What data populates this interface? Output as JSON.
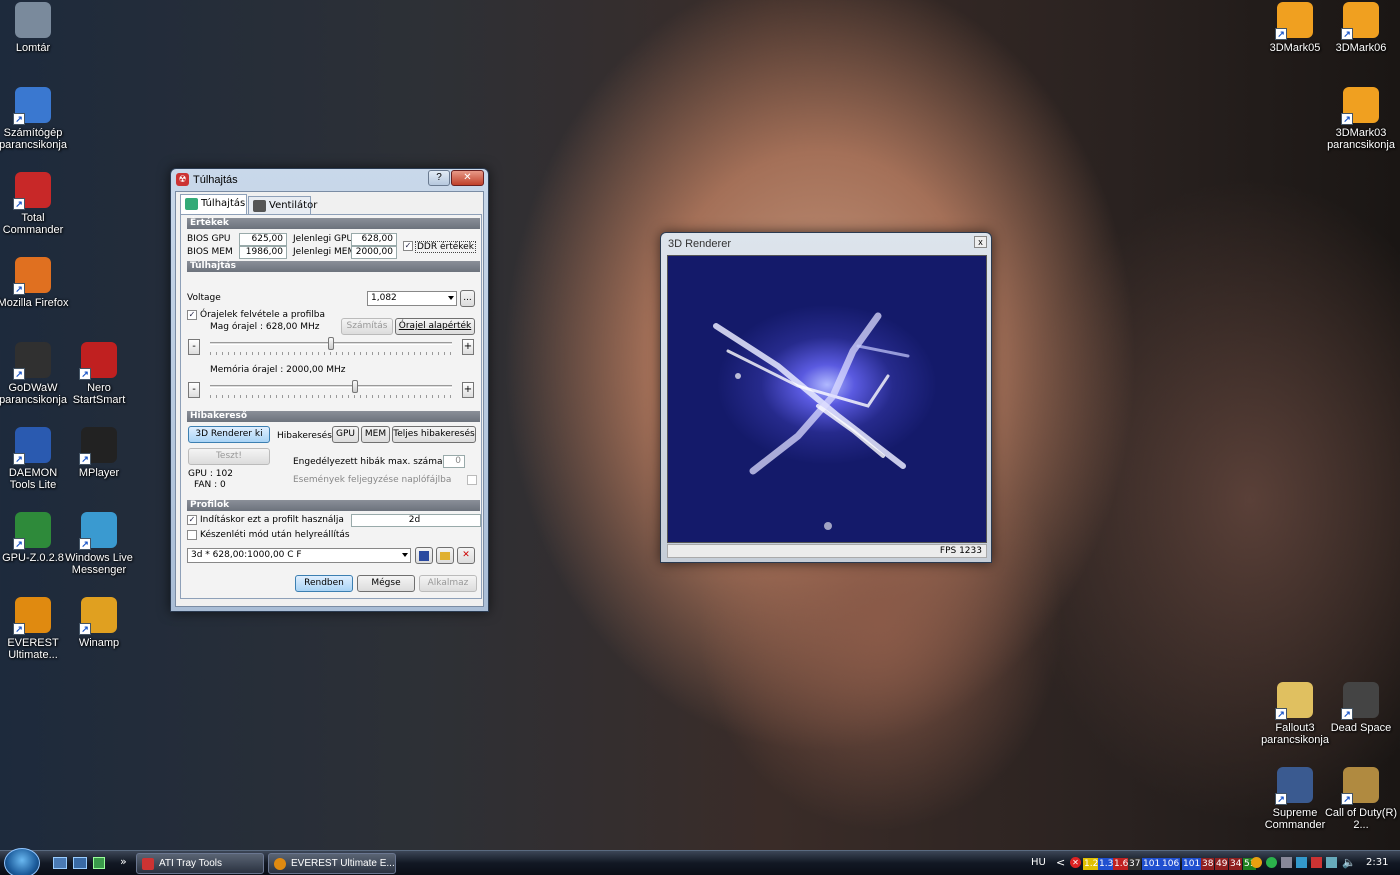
{
  "desktop": {
    "icons_left": [
      {
        "label": "Lomtár",
        "icon": "recycle-bin-icon"
      },
      {
        "label": "Számítógép parancsikonja",
        "icon": "computer-icon"
      },
      {
        "label": "Total Commander",
        "icon": "floppy-icon"
      },
      {
        "label": "Mozilla Firefox",
        "icon": "firefox-icon"
      },
      {
        "label": "GoDWaW parancsikonja",
        "icon": "star-icon"
      },
      {
        "label": "Nero StartSmart",
        "icon": "nero-icon"
      },
      {
        "label": "DAEMON Tools Lite",
        "icon": "daemon-tools-icon"
      },
      {
        "label": "MPlayer",
        "icon": "mplayer-icon"
      },
      {
        "label": "GPU-Z.0.2.8",
        "icon": "gpu-z-icon"
      },
      {
        "label": "Windows Live Messenger",
        "icon": "messenger-icon"
      },
      {
        "label": "EVEREST Ultimate...",
        "icon": "everest-icon"
      },
      {
        "label": "Winamp",
        "icon": "winamp-icon"
      }
    ],
    "icons_right": [
      {
        "label": "3DMark05",
        "icon": "3dmark-icon"
      },
      {
        "label": "3DMark06",
        "icon": "3dmark-icon"
      },
      {
        "label": "3DMark03 parancsikonja",
        "icon": "3dmark-icon"
      },
      {
        "label": "Fallout3 parancsikonja",
        "icon": "fallout-icon"
      },
      {
        "label": "Dead Space",
        "icon": "dead-space-icon"
      },
      {
        "label": "Supreme Commander",
        "icon": "supreme-commander-icon"
      },
      {
        "label": "Call of Duty(R) 2...",
        "icon": "call-of-duty-icon"
      }
    ]
  },
  "overclock": {
    "title": "Túlhajtás",
    "help": "?",
    "close": "✕",
    "tabs": [
      "Túlhajtás",
      "Ventilátor"
    ],
    "values_header": "Értékek",
    "bios_gpu_label": "BIOS GPU",
    "bios_gpu": "625,00",
    "bios_mem_label": "BIOS MEM",
    "bios_mem": "1986,00",
    "cur_gpu_label": "Jelenlegi GPU",
    "cur_gpu": "628,00",
    "cur_mem_label": "Jelenlegi MEM",
    "cur_mem": "2000,00",
    "ddr_label": "DDR értékek",
    "overclock_header": "Túlhajtás",
    "voltage_label": "Voltage",
    "voltage_value": "1,082",
    "voltage_more": "...",
    "record_label": "Órajelek felvétele a profilba",
    "core_label": "Mag órajel : 628,00 MHz",
    "calc_button": "Számítás",
    "default_button": "Órajel alapérték",
    "core_fraction": 0.5,
    "mem_label": "Memória órajel : 2000,00 MHz",
    "mem_fraction": 0.6,
    "minus": "-",
    "plus": "+",
    "debug_header": "Hibakereső",
    "renderer_button": "3D Renderer ki",
    "debug_label": "Hibakeresés",
    "gpu_button": "GPU",
    "mem_button": "MEM",
    "full_button": "Teljes hibakeresés",
    "test_button": "Teszt!",
    "gpu_temp": "GPU : 102",
    "fan_value": "FAN : 0",
    "allowed_errors_label": "Engedélyezett hibák max. száma",
    "allowed_errors": "0",
    "log_label": "Események feljegyzése naplófájlba",
    "profiles_header": "Profilok",
    "startup_label": "Indításkor ezt a profilt használja",
    "startup_value": "2d",
    "standby_label": "Készenléti mód után helyreállítás",
    "profile_value": "3d * 628,00:1000,00 C  F",
    "ok": "Rendben",
    "cancel": "Mégse",
    "apply": "Alkalmaz"
  },
  "renderer": {
    "title": "3D Renderer",
    "close": "x",
    "fps": "FPS 1233"
  },
  "taskbar": {
    "buttons": [
      "ATI Tray Tools",
      "EVEREST Ultimate E..."
    ],
    "chevron": "»",
    "lang": "HU",
    "tray_left": "<",
    "tray_numbers": [
      "1.2",
      "1.3",
      "1.6",
      "37",
      "101",
      "106",
      "101",
      "38",
      "49",
      "34",
      "51"
    ],
    "clock": "2:31"
  }
}
